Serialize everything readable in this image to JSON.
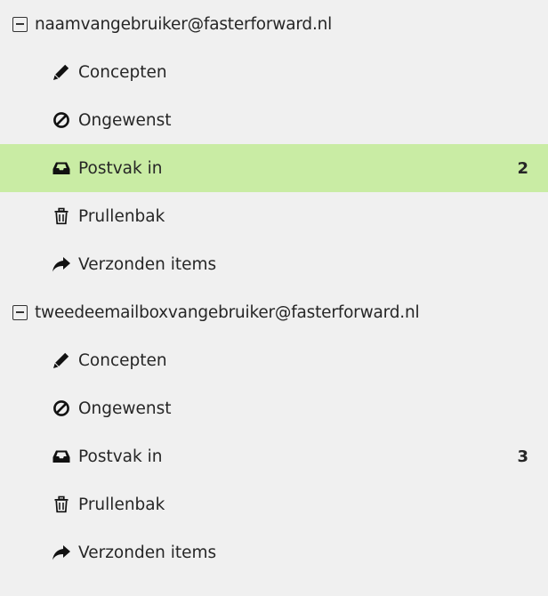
{
  "accounts": [
    {
      "email": "naamvangebruiker@fasterforward.nl",
      "expanded": true,
      "folders": [
        {
          "icon": "pencil-icon",
          "label": "Concepten",
          "count": ""
        },
        {
          "icon": "ban-icon",
          "label": "Ongewenst",
          "count": ""
        },
        {
          "icon": "inbox-icon",
          "label": "Postvak in",
          "count": "2",
          "selected": true
        },
        {
          "icon": "trash-icon",
          "label": "Prullenbak",
          "count": ""
        },
        {
          "icon": "share-arrow-icon",
          "label": "Verzonden items",
          "count": ""
        }
      ]
    },
    {
      "email": "tweedeemailboxvangebruiker@fasterforward.nl",
      "expanded": true,
      "folders": [
        {
          "icon": "pencil-icon",
          "label": "Concepten",
          "count": ""
        },
        {
          "icon": "ban-icon",
          "label": "Ongewenst",
          "count": ""
        },
        {
          "icon": "inbox-icon",
          "label": "Postvak in",
          "count": "3",
          "selected": false
        },
        {
          "icon": "trash-icon",
          "label": "Prullenbak",
          "count": ""
        },
        {
          "icon": "share-arrow-icon",
          "label": "Verzonden items",
          "count": ""
        }
      ]
    }
  ],
  "colors": {
    "background": "#f0f0f0",
    "selected_row": "#c9eca4",
    "text": "#262626"
  }
}
